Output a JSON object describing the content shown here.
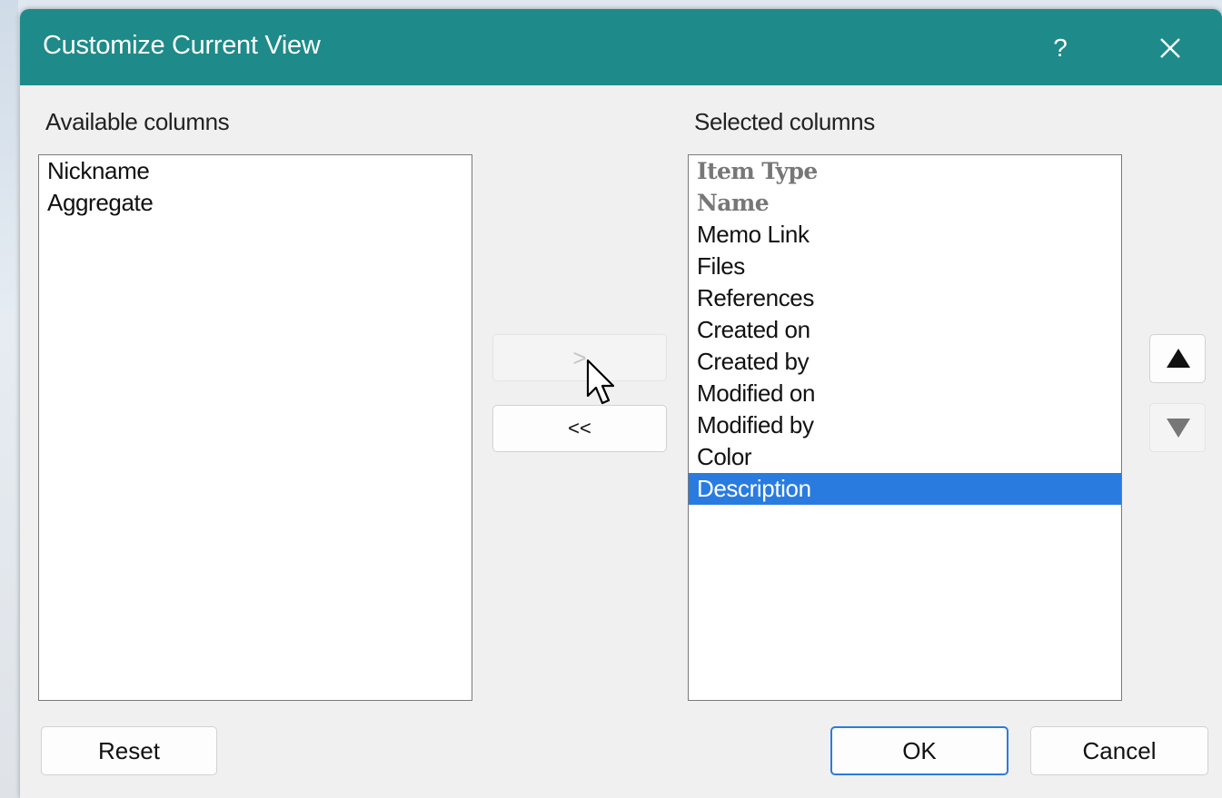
{
  "dialog": {
    "title": "Customize Current View",
    "help_label": "?",
    "close_icon": "close-icon"
  },
  "available": {
    "label": "Available columns",
    "items": [
      "Nickname",
      "Aggregate"
    ]
  },
  "selected": {
    "label": "Selected columns",
    "items": [
      {
        "label": "Item Type",
        "fixed": true
      },
      {
        "label": "Name",
        "fixed": true
      },
      {
        "label": "Memo Link"
      },
      {
        "label": "Files"
      },
      {
        "label": "References"
      },
      {
        "label": "Created on"
      },
      {
        "label": "Created by"
      },
      {
        "label": "Modified on"
      },
      {
        "label": "Modified by"
      },
      {
        "label": "Color"
      },
      {
        "label": "Description",
        "selected": true
      }
    ]
  },
  "transfer": {
    "add_label": ">",
    "remove_label": "<<"
  },
  "order": {
    "up_icon": "triangle-up-icon",
    "down_icon": "triangle-down-icon"
  },
  "footer": {
    "reset_label": "Reset",
    "ok_label": "OK",
    "cancel_label": "Cancel"
  },
  "colors": {
    "titlebar": "#1e8a8a",
    "selection": "#2a7be0",
    "dialog_bg": "#f0f0f0"
  }
}
